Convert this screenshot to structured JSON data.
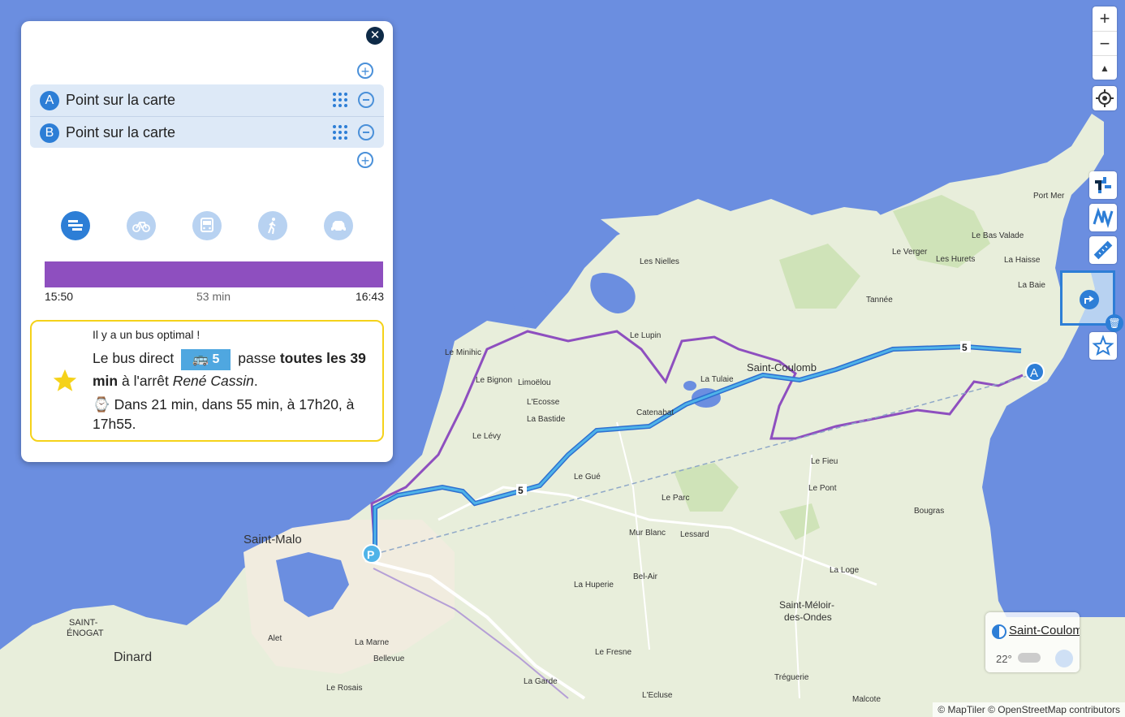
{
  "panel": {
    "stops": [
      {
        "letter": "A",
        "label": "Point sur la carte"
      },
      {
        "letter": "B",
        "label": "Point sur la carte"
      }
    ],
    "modes": [
      "itinerary-summary",
      "bike",
      "bus",
      "walk",
      "car"
    ],
    "timeline": {
      "start": "15:50",
      "duration": "53 min",
      "end": "16:43"
    },
    "info": {
      "title": "Il y a un bus optimal !",
      "text_before": "Le bus direct",
      "bus_line": "5",
      "text_middle": "passe",
      "frequency": "toutes les 39 min",
      "text_stop_prefix": "à l'arrêt",
      "stop_name": "René Cassin",
      "text_end": ".",
      "times": "⌚ Dans 21 min, dans 55 min, à 17h20, à 17h55."
    }
  },
  "map": {
    "labels": {
      "saint_malo": "Saint-Malo",
      "dinard": "Dinard",
      "saint_enogat_1": "SAINT-",
      "saint_enogat_2": "ÉNOGAT",
      "saint_coulomb": "Saint-Coulomb",
      "saint_meloir_1": "Saint-Méloir-",
      "saint_meloir_2": "des-Ondes",
      "les_nielles": "Les Nielles",
      "le_lupin": "Le Lupin",
      "le_minihic": "Le Minihic",
      "le_bignon": "Le Bignon",
      "limoelou": "Limoëlou",
      "l_ecosse": "L'Ecosse",
      "la_bastide": "La Bastide",
      "le_levy": "Le Lévy",
      "catenabat": "Catenabat",
      "la_tulaie": "La Tulaie",
      "tannee": "Tannée",
      "le_verger": "Le Verger",
      "les_hurets": "Les Hurets",
      "le_bas_valade": "Le Bas Valade",
      "la_haisse": "La Haisse",
      "la_baie": "La Baie",
      "port_mer": "Port Mer",
      "le_gue": "Le Gué",
      "le_parc": "Le Parc",
      "le_fieu": "Le Fieu",
      "le_pont": "Le Pont",
      "bougras": "Bougras",
      "mur_blanc": "Mur Blanc",
      "lessard": "Lessard",
      "bel_air": "Bel-Air",
      "la_huperie": "La Huperie",
      "la_loge": "La Loge",
      "aleth": "Alet",
      "la_marne": "La Marne",
      "bellevue": "Bellevue",
      "le_fresne": "Le Fresne",
      "la_garde": "La Garde",
      "le_rosais": "Le Rosais",
      "l_ecluse": "L'Ecluse",
      "tregueire": "Tréguerie",
      "malcote": "Malcote"
    },
    "markers": {
      "a": "A",
      "p": "P",
      "bus_line_label": "5"
    }
  },
  "controls": {
    "zoom_in": "+",
    "zoom_out": "−",
    "north": "▲"
  },
  "weather": {
    "name": "Saint-Coulomb",
    "temp": "22°"
  },
  "attribution": "© MapTiler © OpenStreetMap contributors",
  "colors": {
    "accent": "#2d7ed6",
    "bus": "#4fa7e0",
    "route": "#8e4fbf",
    "highlight": "#f5d21a"
  }
}
